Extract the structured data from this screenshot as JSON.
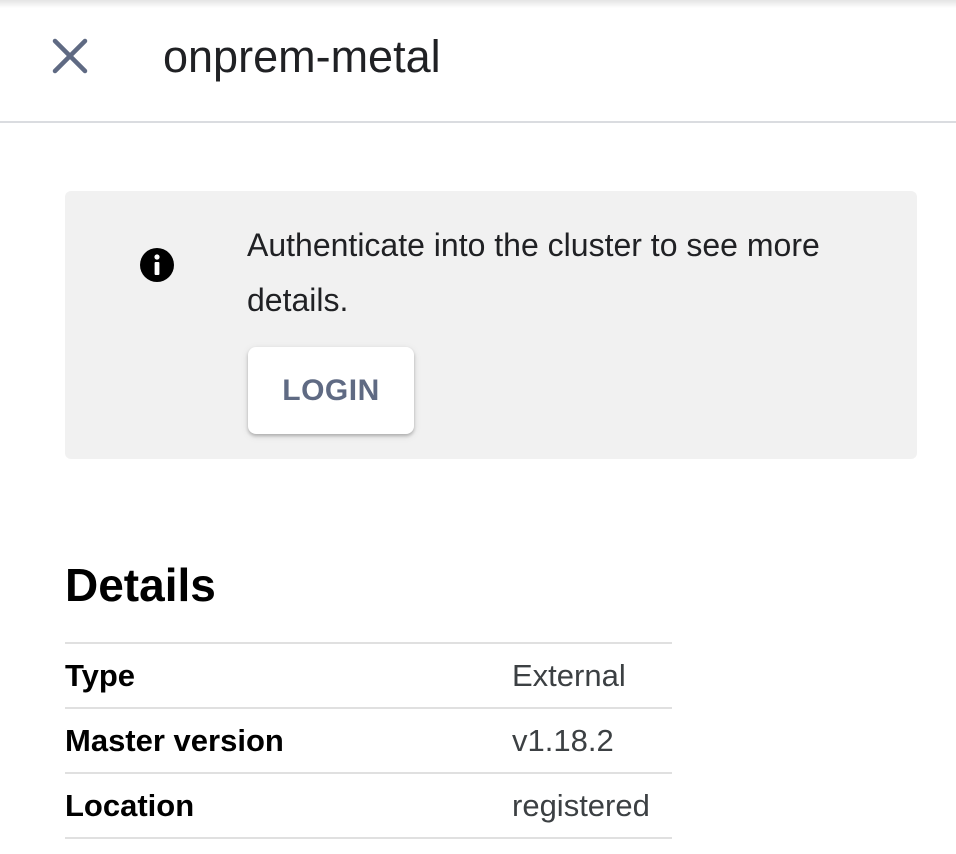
{
  "header": {
    "title": "onprem-metal",
    "close_icon": "close-icon"
  },
  "banner": {
    "icon": "info-icon",
    "message": "Authenticate into the cluster to see more details.",
    "login_label": "LOGIN"
  },
  "details": {
    "heading": "Details",
    "rows": [
      {
        "label": "Type",
        "value": "External"
      },
      {
        "label": "Master version",
        "value": "v1.18.2"
      },
      {
        "label": "Location",
        "value": "registered"
      }
    ]
  },
  "colors": {
    "close_icon": "#5f6a83",
    "banner_bg": "#f1f1f1",
    "button_text": "#5f6a83",
    "divider": "#e0e0e0"
  }
}
